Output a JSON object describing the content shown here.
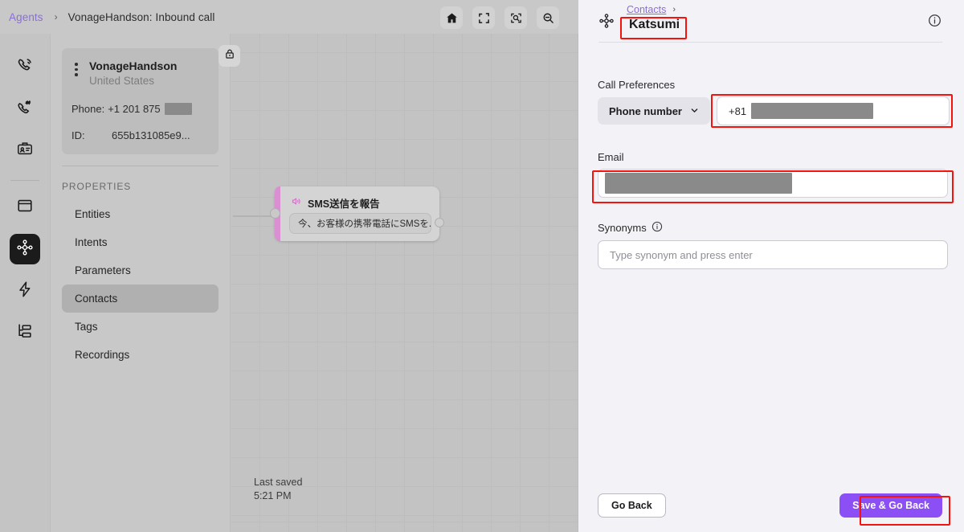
{
  "topbar": {
    "breadcrumb_root": "Agents",
    "breadcrumb_sep": "›",
    "breadcrumb_current": "VonageHandson: Inbound call",
    "tools": [
      {
        "name": "home-icon",
        "label": "Home"
      },
      {
        "name": "fit-screen-icon",
        "label": "Fit to screen"
      },
      {
        "name": "zoom-to-selection-icon",
        "label": "Zoom to selection"
      },
      {
        "name": "zoom-out-icon",
        "label": "Zoom out"
      }
    ]
  },
  "rail": {
    "items": [
      {
        "name": "phone-ringing-icon",
        "label": "Calls",
        "active": false
      },
      {
        "name": "phone-number-icon",
        "label": "Numbers",
        "active": false
      },
      {
        "name": "id-card-icon",
        "label": "Identity",
        "active": false
      },
      {
        "name": "window-icon",
        "label": "Workspace",
        "active": false
      },
      {
        "name": "flow-node-icon",
        "label": "Flow builder",
        "active": true
      },
      {
        "name": "lightning-icon",
        "label": "Events",
        "active": false
      },
      {
        "name": "hierarchy-icon",
        "label": "Structure",
        "active": false
      }
    ]
  },
  "properties_panel": {
    "agent_card": {
      "name": "VonageHandson",
      "country": "United States",
      "phone_label": "Phone:",
      "phone_value": "+1 201 875",
      "phone_redacted": true,
      "id_label": "ID:",
      "id_value": "655b131085e9..."
    },
    "lock_button_label": "Lock canvas",
    "section_title": "PROPERTIES",
    "items": [
      {
        "label": "Entities",
        "active": false
      },
      {
        "label": "Intents",
        "active": false
      },
      {
        "label": "Parameters",
        "active": false
      },
      {
        "label": "Contacts",
        "active": true
      },
      {
        "label": "Tags",
        "active": false
      },
      {
        "label": "Recordings",
        "active": false
      }
    ]
  },
  "canvas": {
    "node": {
      "icon": "speaker-icon",
      "title": "SMS送信を報告",
      "body_text": "今、お客様の携帯電話にSMSを...",
      "accent_color": "#d98fd1"
    },
    "last_saved_label": "Last saved",
    "last_saved_time": "5:21 PM"
  },
  "drawer": {
    "icon": "flow-node-icon",
    "breadcrumb_link": "Contacts",
    "breadcrumb_sep": "›",
    "title": "Katsumi",
    "info_icon": "info-icon",
    "call_preferences": {
      "label": "Call Preferences",
      "select_value": "Phone number",
      "select_options": [
        "Phone number"
      ],
      "phone_prefix": "+81",
      "phone_redacted": true
    },
    "email": {
      "label": "Email",
      "value_redacted": true
    },
    "synonyms": {
      "label": "Synonyms",
      "info_icon": "info-icon",
      "placeholder": "Type synonym and press enter",
      "value": ""
    },
    "footer": {
      "go_back_label": "Go Back",
      "save_label": "Save & Go Back"
    }
  },
  "colors": {
    "accent_purple": "#8b4ff5",
    "link_purple": "#8b6fd4",
    "annotation_red": "#f5140d",
    "node_accent_pink": "#d98fd1",
    "drawer_bg": "#f3f2f7"
  }
}
